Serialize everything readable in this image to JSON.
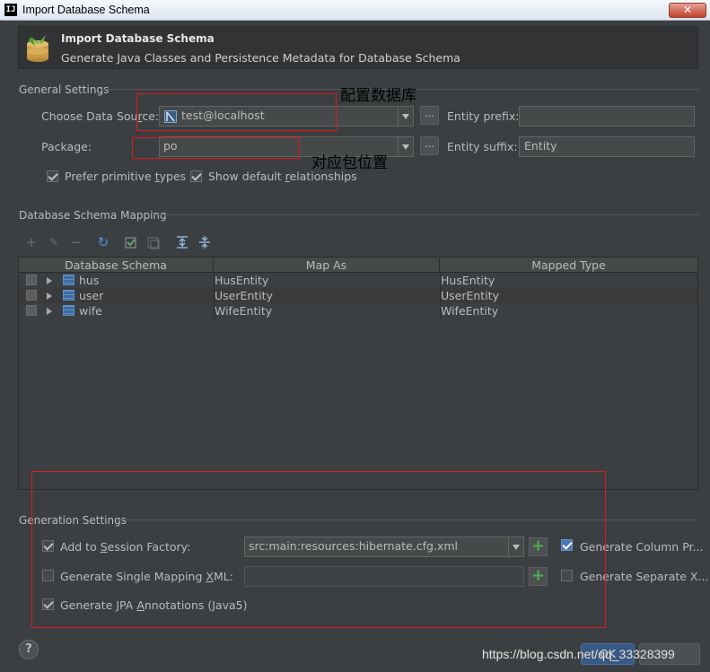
{
  "window": {
    "title": "Import Database Schema",
    "close_glyph": "✕"
  },
  "banner": {
    "title": "Import Database Schema",
    "subtitle": "Generate Java Classes and Persistence Metadata for Database Schema"
  },
  "general": {
    "section_title": "General Settings",
    "data_source_label": "Choose Data Source:",
    "data_source_value": "test@localhost",
    "package_label": "Package:",
    "package_value": "po",
    "entity_prefix_label": "Entity prefix:",
    "entity_prefix_value": "",
    "entity_suffix_label": "Entity suffix:",
    "entity_suffix_value": "Entity",
    "prefer_primitive_label": "Prefer primitive types",
    "prefer_primitive_checked": true,
    "show_default_rel_label": "Show default relationships",
    "show_default_rel_checked": true,
    "dots_label": "..."
  },
  "annotations": {
    "configure_datasource": "配置数据库",
    "package_location": "对应包位置"
  },
  "mapping": {
    "section_title": "Database Schema Mapping",
    "columns": [
      "Database Schema",
      "Map As",
      "Mapped Type"
    ],
    "rows": [
      {
        "schema": "hus",
        "map_as": "HusEntity",
        "mapped_type": "HusEntity"
      },
      {
        "schema": "user",
        "map_as": "UserEntity",
        "mapped_type": "UserEntity"
      },
      {
        "schema": "wife",
        "map_as": "WifeEntity",
        "mapped_type": "WifeEntity"
      }
    ]
  },
  "generation": {
    "section_title": "Generation Settings",
    "add_session_factory_label": "Add to Session Factory:",
    "add_session_factory_checked": true,
    "session_factory_value": "src:main:resources:hibernate.cfg.xml",
    "single_mapping_label": "Generate Single Mapping XML:",
    "single_mapping_checked": false,
    "single_mapping_value": "",
    "jpa_annotations_label": "Generate JPA Annotations (Java5)",
    "jpa_annotations_checked": true,
    "generate_column_props_label": "Generate Column Pr...",
    "generate_column_props_checked": true,
    "generate_separate_label": "Generate Separate X...",
    "generate_separate_checked": false
  },
  "footer": {
    "help_label": "?",
    "ok_label": "OK",
    "cancel_label": "",
    "watermark": "https://blog.csdn.net/qq_33328399"
  }
}
